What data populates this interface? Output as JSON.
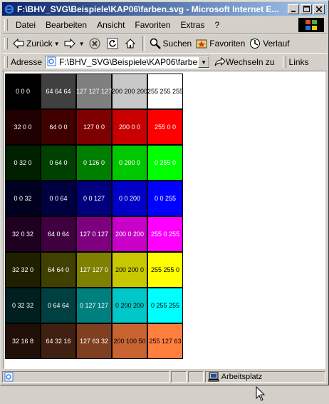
{
  "window": {
    "title": "F:\\BHV_SVG\\Beispiele\\KAP06\\farben.svg - Microsoft Internet E..."
  },
  "menu": [
    "Datei",
    "Bearbeiten",
    "Ansicht",
    "Favoriten",
    "Extras",
    "?"
  ],
  "toolbar": {
    "back": "Zurück",
    "search": "Suchen",
    "favorites": "Favoriten",
    "history": "Verlauf"
  },
  "address": {
    "label": "Adresse",
    "value": "F:\\BHV_SVG\\Beispiele\\KAP06\\farben.svg",
    "go": "Wechseln zu",
    "links": "Links"
  },
  "swatches": [
    [
      {
        "label": "0 0 0",
        "bg": "#000000",
        "fg": "#ffffff"
      },
      {
        "label": "64 64 64",
        "bg": "#404040",
        "fg": "#ffffff"
      },
      {
        "label": "127 127 127",
        "bg": "#7f7f7f",
        "fg": "#ffffff"
      },
      {
        "label": "200 200 200",
        "bg": "#c8c8c8",
        "fg": "#000000"
      },
      {
        "label": "255 255 255",
        "bg": "#ffffff",
        "fg": "#000000"
      }
    ],
    [
      {
        "label": "32 0 0",
        "bg": "#200000",
        "fg": "#ffffff"
      },
      {
        "label": "64 0 0",
        "bg": "#400000",
        "fg": "#ffffff"
      },
      {
        "label": "127 0 0",
        "bg": "#7f0000",
        "fg": "#ffffff"
      },
      {
        "label": "200 0 0",
        "bg": "#c80000",
        "fg": "#ffffff"
      },
      {
        "label": "255 0 0",
        "bg": "#ff0000",
        "fg": "#ffffff"
      }
    ],
    [
      {
        "label": "0 32 0",
        "bg": "#002000",
        "fg": "#ffffff"
      },
      {
        "label": "0 64 0",
        "bg": "#004000",
        "fg": "#ffffff"
      },
      {
        "label": "0 126 0",
        "bg": "#007e00",
        "fg": "#ffffff"
      },
      {
        "label": "0 200 0",
        "bg": "#00c800",
        "fg": "#ffffff"
      },
      {
        "label": "0 255 0",
        "bg": "#00ff00",
        "fg": "#ffffff"
      }
    ],
    [
      {
        "label": "0 0 32",
        "bg": "#000020",
        "fg": "#ffffff"
      },
      {
        "label": "0 0 64",
        "bg": "#000040",
        "fg": "#ffffff"
      },
      {
        "label": "0 0 127",
        "bg": "#00007f",
        "fg": "#ffffff"
      },
      {
        "label": "0 0 200",
        "bg": "#0000c8",
        "fg": "#ffffff"
      },
      {
        "label": "0 0 255",
        "bg": "#0000ff",
        "fg": "#ffffff"
      }
    ],
    [
      {
        "label": "32 0 32",
        "bg": "#200020",
        "fg": "#ffffff"
      },
      {
        "label": "64 0 64",
        "bg": "#400040",
        "fg": "#ffffff"
      },
      {
        "label": "127 0 127",
        "bg": "#7f007f",
        "fg": "#ffffff"
      },
      {
        "label": "200 0 200",
        "bg": "#c800c8",
        "fg": "#ffffff"
      },
      {
        "label": "255 0 255",
        "bg": "#ff00ff",
        "fg": "#ffffff"
      }
    ],
    [
      {
        "label": "32 32 0",
        "bg": "#202000",
        "fg": "#ffffff"
      },
      {
        "label": "64 64 0",
        "bg": "#404000",
        "fg": "#ffffff"
      },
      {
        "label": "127 127 0",
        "bg": "#7f7f00",
        "fg": "#ffffff"
      },
      {
        "label": "200 200 0",
        "bg": "#c8c800",
        "fg": "#000000"
      },
      {
        "label": "255 255 0",
        "bg": "#ffff00",
        "fg": "#000000"
      }
    ],
    [
      {
        "label": "0 32 32",
        "bg": "#002020",
        "fg": "#ffffff"
      },
      {
        "label": "0 64 64",
        "bg": "#004040",
        "fg": "#ffffff"
      },
      {
        "label": "0 127 127",
        "bg": "#007f7f",
        "fg": "#ffffff"
      },
      {
        "label": "0 200 200",
        "bg": "#00c8c8",
        "fg": "#000000"
      },
      {
        "label": "0 255 255",
        "bg": "#00ffff",
        "fg": "#000000"
      }
    ],
    [
      {
        "label": "32 16 8",
        "bg": "#201008",
        "fg": "#ffffff"
      },
      {
        "label": "64 32 16",
        "bg": "#402010",
        "fg": "#ffffff"
      },
      {
        "label": "127 63 32",
        "bg": "#7f3f20",
        "fg": "#ffffff"
      },
      {
        "label": "200 100 50",
        "bg": "#c86432",
        "fg": "#000000"
      },
      {
        "label": "255 127 63",
        "bg": "#ff7f3f",
        "fg": "#000000"
      }
    ]
  ],
  "status": {
    "zone": "Arbeitsplatz"
  }
}
